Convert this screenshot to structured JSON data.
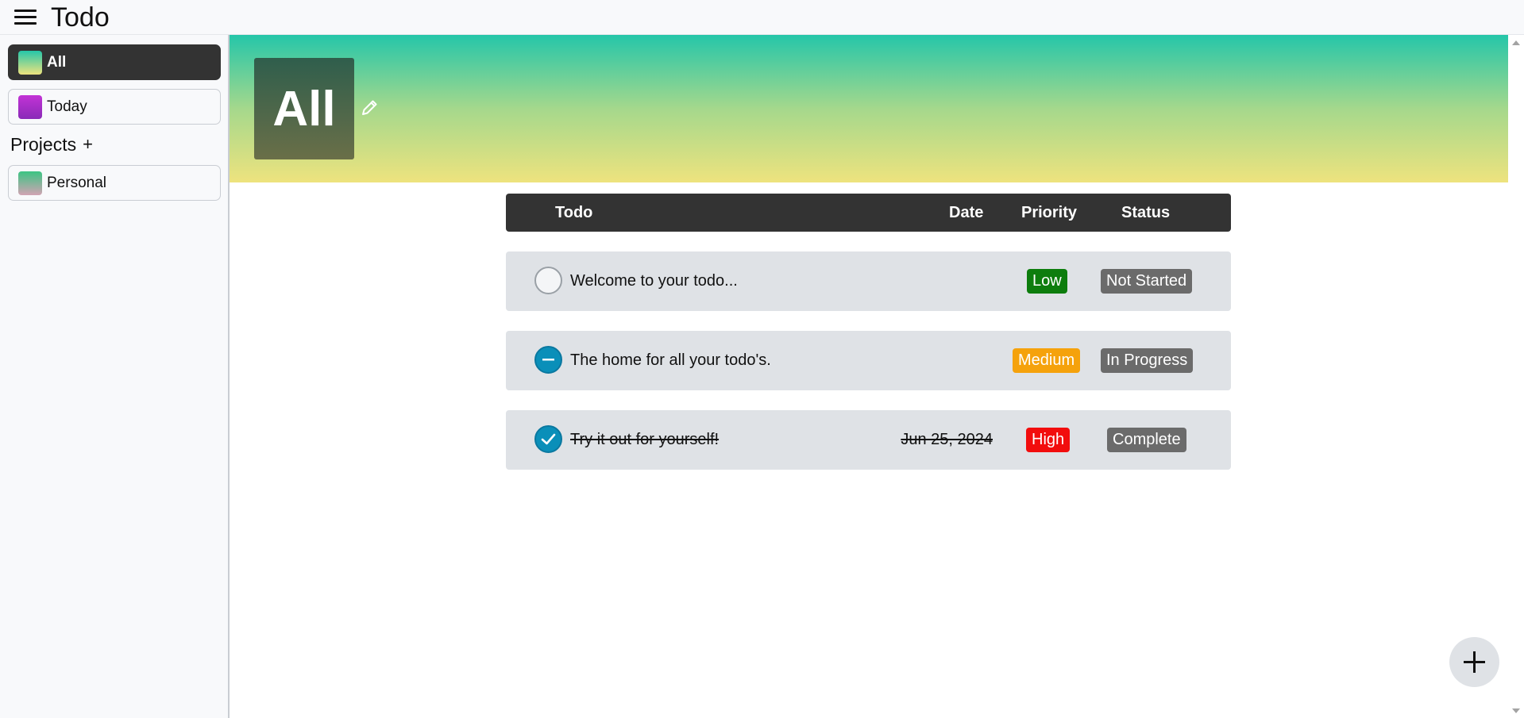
{
  "app": {
    "title": "Todo"
  },
  "sidebar": {
    "items": [
      {
        "label": "All",
        "swatch": "linear-gradient(to bottom, #25c6a9, #eee37e)",
        "active": true
      },
      {
        "label": "Today",
        "swatch": "linear-gradient(to bottom, #c233d6, #8a2ab8)",
        "active": false
      }
    ],
    "projects_label": "Projects",
    "projects_add": "+",
    "projects": [
      {
        "label": "Personal",
        "swatch": "linear-gradient(to bottom, #3cc483, #d1a3b3)"
      }
    ]
  },
  "main": {
    "project_title": "All",
    "columns": {
      "todo": "Todo",
      "date": "Date",
      "priority": "Priority",
      "status": "Status"
    },
    "todos": [
      {
        "title": "Welcome to your todo...",
        "date": "",
        "priority": "Low",
        "priority_color": "#0d7d0d",
        "status": "Not Started",
        "state": "not-started"
      },
      {
        "title": "The home for all your todo's.",
        "date": "",
        "priority": "Medium",
        "priority_color": "#f5a20c",
        "status": "In Progress",
        "state": "in-progress"
      },
      {
        "title": "Try it out for yourself!",
        "date": "Jun 25, 2024",
        "priority": "High",
        "priority_color": "#f20d0d",
        "status": "Complete",
        "state": "complete"
      }
    ]
  },
  "icons": {
    "menu": "hamburger-icon",
    "edit": "pencil-icon",
    "add": "plus-icon",
    "checkbox_in_progress": "minus-icon",
    "checkbox_complete": "checkmark-icon"
  },
  "colors": {
    "dark": "#333333",
    "row_bg": "#dfe2e6",
    "accent": "#0a8fb9",
    "status_badge": "#6b6b6b"
  }
}
